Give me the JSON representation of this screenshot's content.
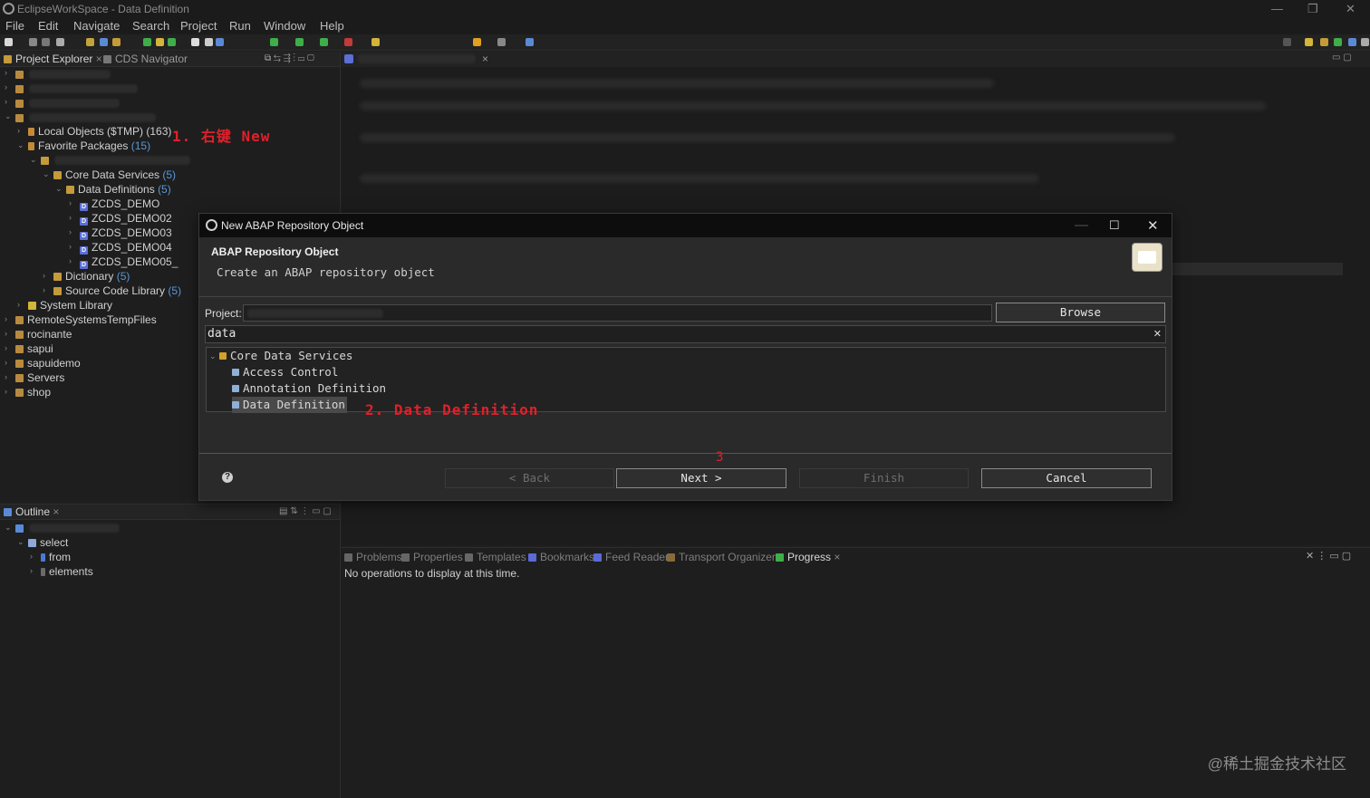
{
  "window": {
    "title": "EclipseWorkSpace - Data Definition",
    "min": "—",
    "max": "❐",
    "close": "✕"
  },
  "menu": [
    "File",
    "Edit",
    "Navigate",
    "Search",
    "Project",
    "Run",
    "Window",
    "Help"
  ],
  "explorer": {
    "tabs": [
      "Project Explorer",
      "CDS Navigator"
    ],
    "items": {
      "local_objects": {
        "label": "Local Objects ($TMP) (163)"
      },
      "favorite_packages": {
        "label": "Favorite Packages",
        "count": "(15)"
      },
      "core_data_services": {
        "label": "Core Data Services",
        "count": "(5)"
      },
      "data_definitions": {
        "label": "Data Definitions",
        "count": "(5)"
      },
      "zcds": [
        "ZCDS_DEMO",
        "ZCDS_DEMO02",
        "ZCDS_DEMO03",
        "ZCDS_DEMO04",
        "ZCDS_DEMO05_"
      ],
      "dictionary": {
        "label": "Dictionary",
        "count": "(5)"
      },
      "source_code_library": {
        "label": "Source Code Library",
        "count": "(5)"
      },
      "system_library": {
        "label": "System Library"
      },
      "projects": [
        "RemoteSystemsTempFiles",
        "rocinante",
        "sapui",
        "sapuidemo",
        "Servers",
        "shop"
      ]
    }
  },
  "outline": {
    "tab": "Outline",
    "items": [
      "select",
      "from",
      "elements"
    ]
  },
  "bottom_panel": {
    "tabs": [
      "Problems",
      "Properties",
      "Templates",
      "Bookmarks",
      "Feed Reader",
      "Transport Organizer",
      "Progress"
    ],
    "active": "Progress",
    "message": "No operations to display at this time."
  },
  "dialog": {
    "title": "New ABAP Repository Object",
    "header_title": "ABAP Repository Object",
    "header_desc": "Create an ABAP repository object",
    "project_label": "Project:",
    "project_value": "",
    "browse": "Browse",
    "filter_value": "data",
    "clear_icon": "✕",
    "tree": {
      "group": "Core Data Services",
      "items": [
        "Access Control",
        "Annotation Definition",
        "Data Definition"
      ],
      "selected": "Data Definition"
    },
    "buttons": {
      "back": "< Back",
      "next": "Next >",
      "finish": "Finish",
      "cancel": "Cancel"
    },
    "help_icon": "?"
  },
  "annotations": {
    "step1": "1. 右键 New",
    "step2": "2. Data Definition",
    "step3": "3"
  },
  "watermark": "@稀土掘金技术社区"
}
